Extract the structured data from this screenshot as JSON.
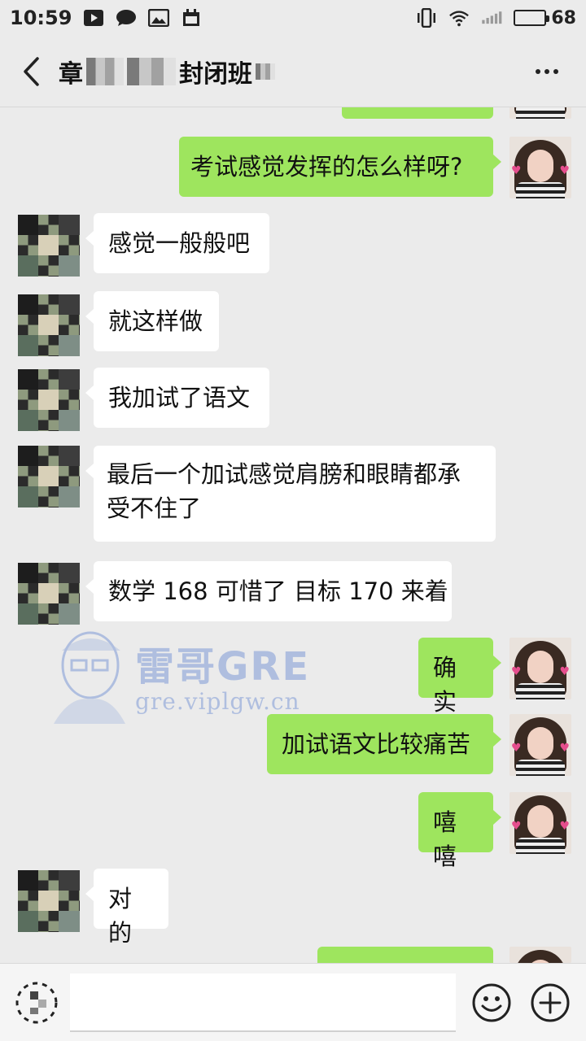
{
  "status_bar": {
    "time": "10:59",
    "battery": "68",
    "battery_level": 0.68,
    "icons": [
      "play-icon",
      "message-icon",
      "image-icon",
      "calendar-icon",
      "vibrate-icon",
      "wifi-icon",
      "signal-icon",
      "battery-icon"
    ]
  },
  "header": {
    "title_prefix": "章",
    "title_suffix": "封闭班",
    "back_icon": "chevron-left-icon",
    "more_icon": "more-dots-icon"
  },
  "messages": [
    {
      "side": "right",
      "text": "考试感觉发挥的怎么样呀?"
    },
    {
      "side": "left",
      "text": "感觉一般般吧"
    },
    {
      "side": "left",
      "text": "就这样做"
    },
    {
      "side": "left",
      "text": "我加试了语文"
    },
    {
      "side": "left",
      "line1": "最后一个加试感觉肩膀和眼睛都承",
      "line2": "受不住了"
    },
    {
      "side": "left",
      "text": "数学 168 可惜了 目标 170 来着"
    },
    {
      "side": "right",
      "text": "确实"
    },
    {
      "side": "right",
      "text": "加试语文比较痛苦"
    },
    {
      "side": "right",
      "text": "嘻嘻"
    },
    {
      "side": "left",
      "text": "对的"
    }
  ],
  "watermark": {
    "title": "雷哥GRE",
    "url": "gre.viplgw.cn"
  },
  "input_bar": {
    "voice_icon": "voice-icon",
    "emoji_icon": "emoji-icon",
    "plus_icon": "plus-icon",
    "input_value": ""
  },
  "colors": {
    "background": "#ebebeb",
    "bubble_sent": "#9ee55e",
    "bubble_received": "#ffffff"
  }
}
